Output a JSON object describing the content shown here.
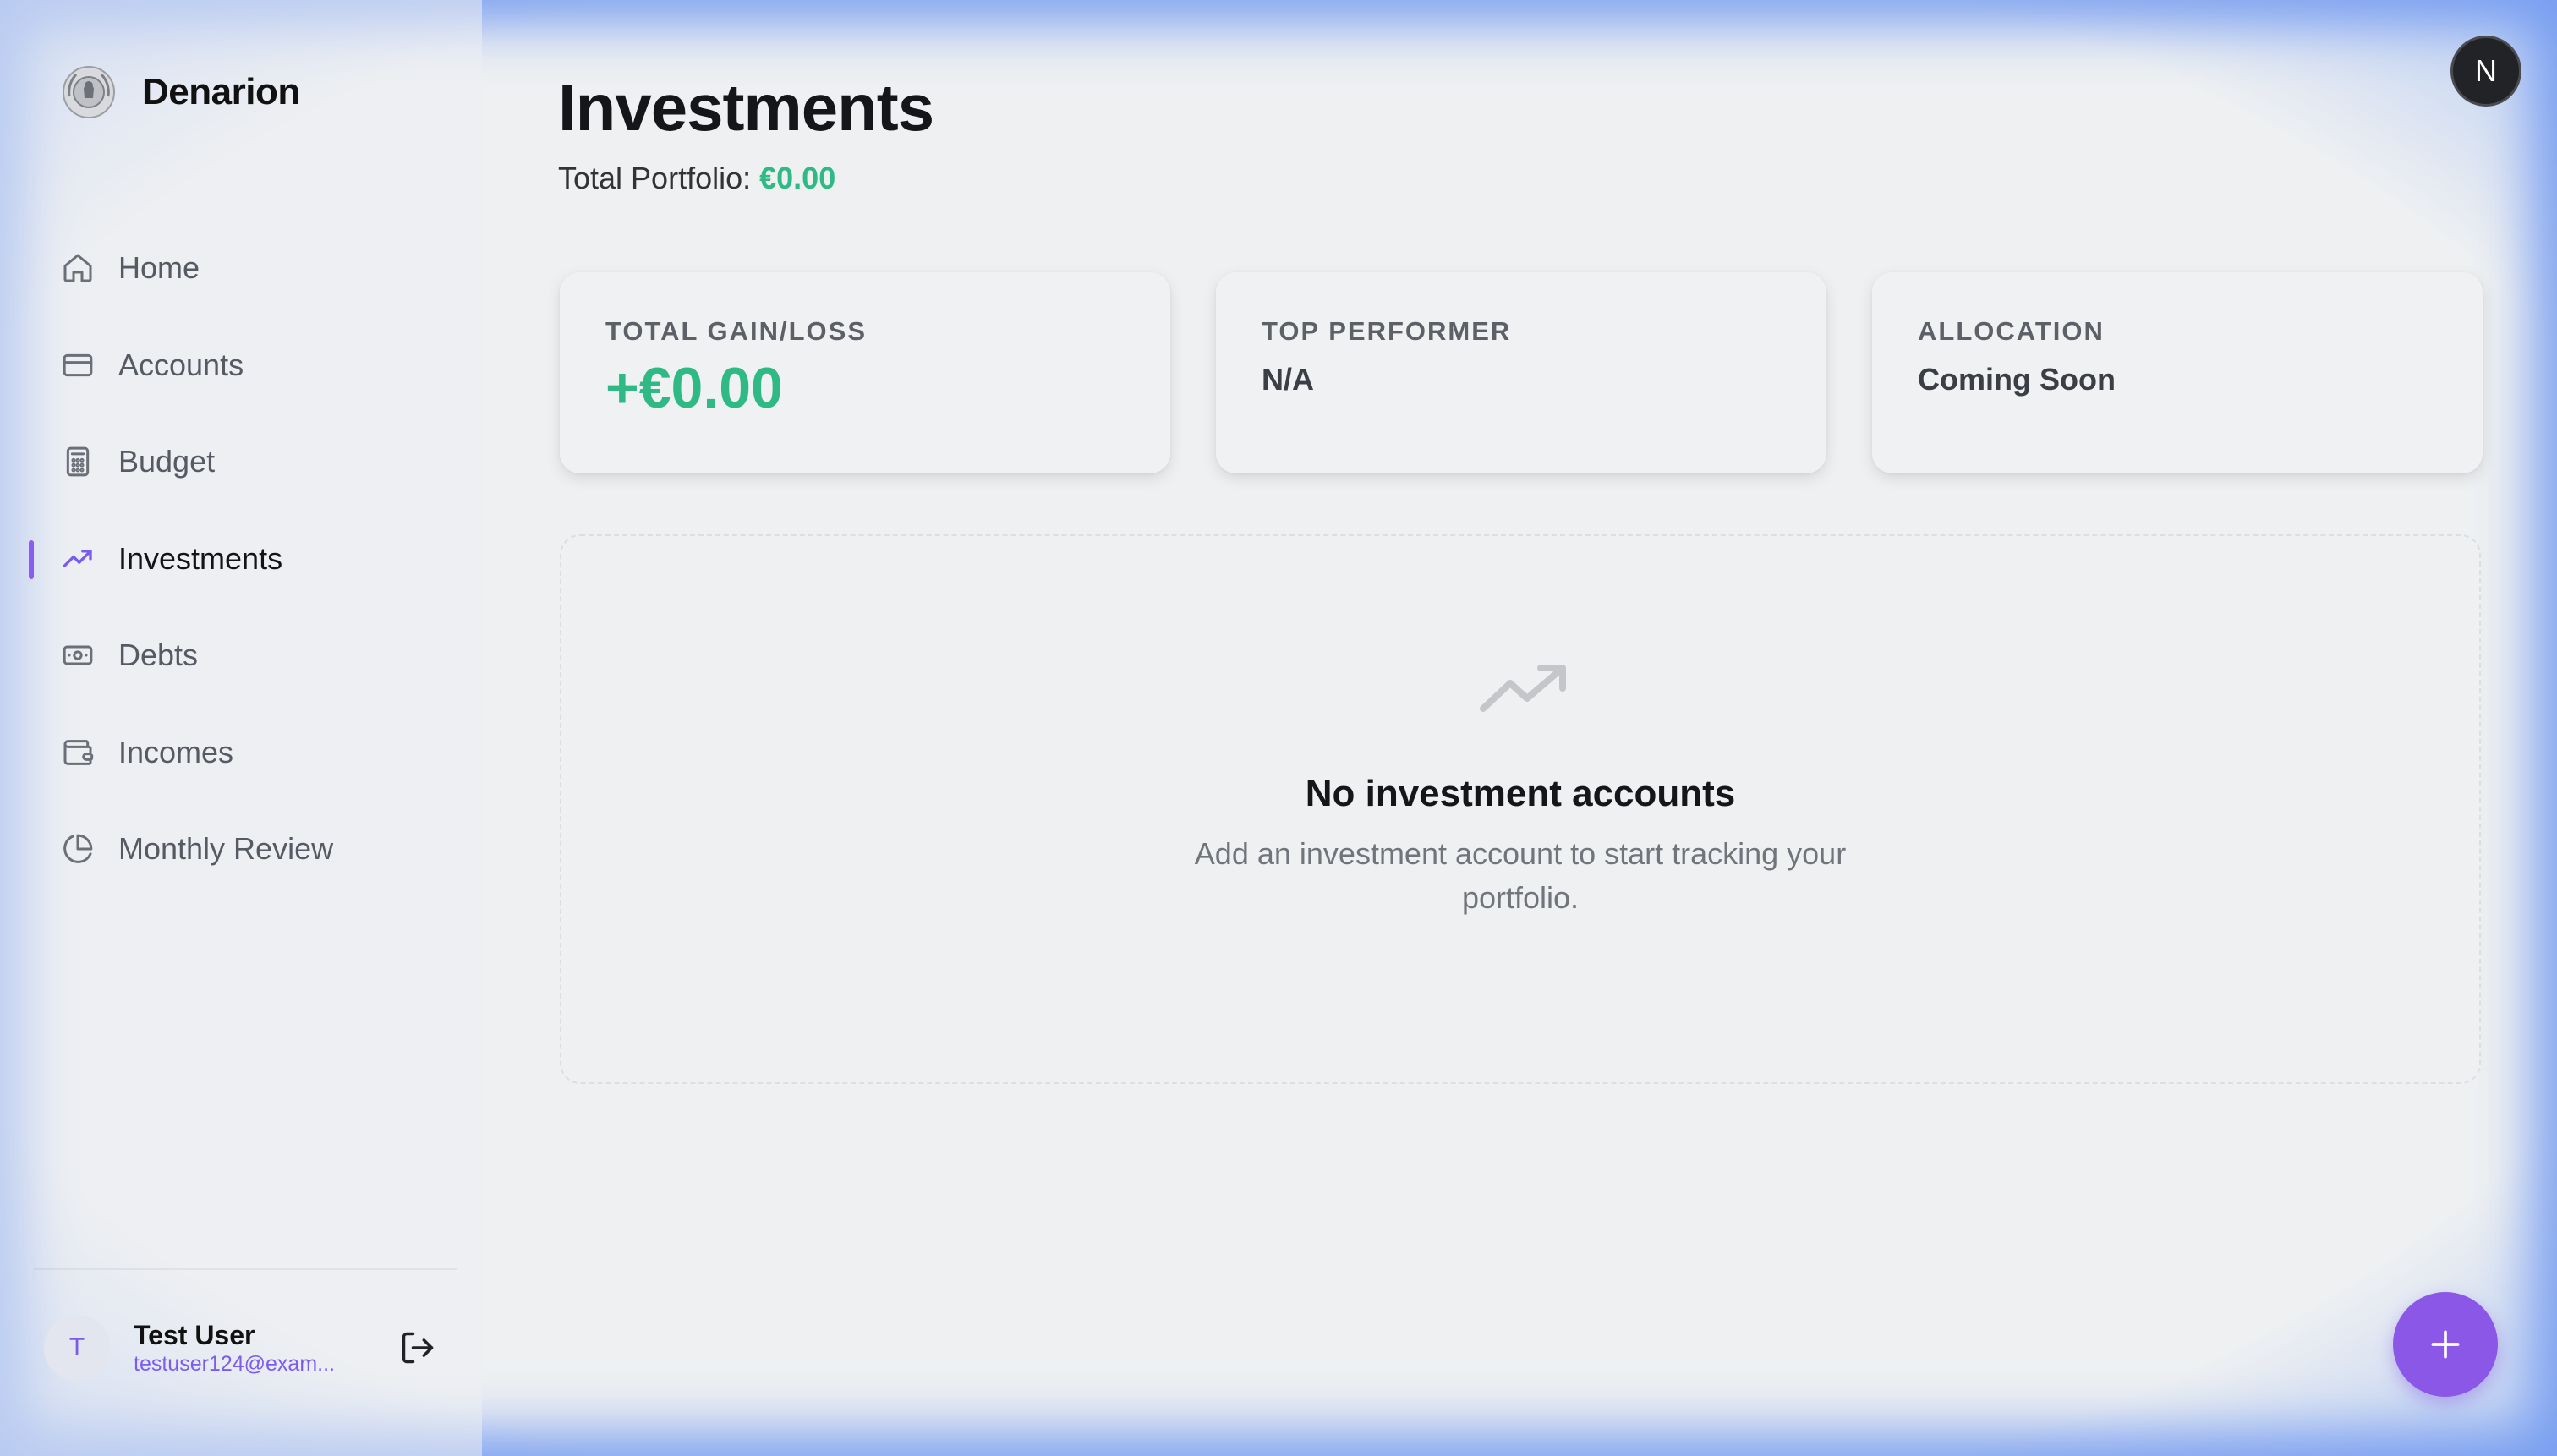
{
  "app": {
    "name": "Denarion",
    "logo_icon": "laurel-seal-icon"
  },
  "sidebar": {
    "items": [
      {
        "label": "Home",
        "icon": "home-icon"
      },
      {
        "label": "Accounts",
        "icon": "credit-card-icon"
      },
      {
        "label": "Budget",
        "icon": "calculator-icon"
      },
      {
        "label": "Investments",
        "icon": "trending-up-icon",
        "active": true
      },
      {
        "label": "Debts",
        "icon": "banknote-icon"
      },
      {
        "label": "Incomes",
        "icon": "wallet-icon"
      },
      {
        "label": "Monthly Review",
        "icon": "pie-chart-icon"
      }
    ],
    "active_accent": "#8a5cf0"
  },
  "user": {
    "initial": "T",
    "name": "Test User",
    "email": "testuser124@exam...",
    "logout_icon": "log-out-icon"
  },
  "page": {
    "title": "Investments",
    "portfolio_label": "Total Portfolio:",
    "portfolio_value": "€0.00"
  },
  "cards": [
    {
      "label": "TOTAL GAIN/LOSS",
      "value": "+€0.00"
    },
    {
      "label": "TOP PERFORMER",
      "value": "N/A"
    },
    {
      "label": "ALLOCATION",
      "value": "Coming Soon"
    }
  ],
  "empty_state": {
    "icon": "trending-up-icon",
    "title": "No investment accounts",
    "description": "Add an investment account to start tracking your portfolio."
  },
  "corner_badge": {
    "letter": "N"
  },
  "fab": {
    "icon": "plus-icon",
    "color": "#8b57e6"
  },
  "colors": {
    "positive": "#2fb985",
    "accent": "#8a5cf0"
  }
}
